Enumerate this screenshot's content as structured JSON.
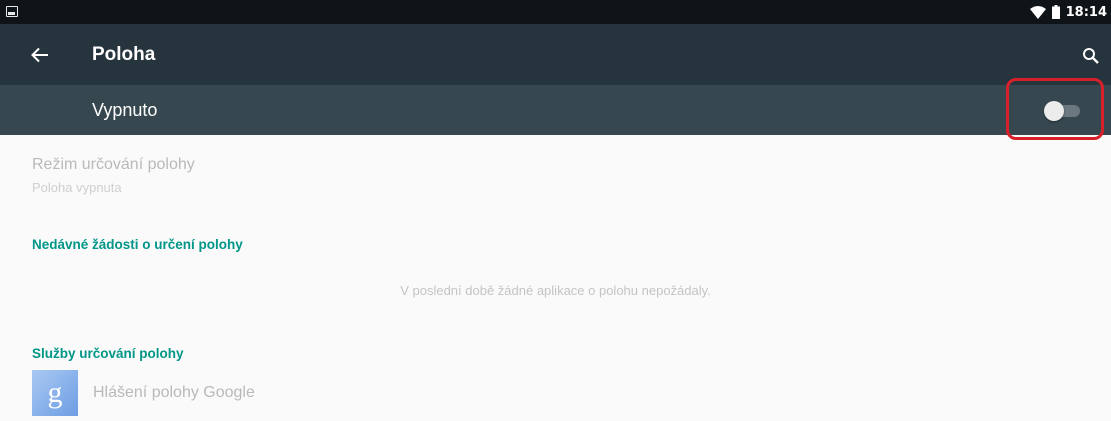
{
  "status_bar": {
    "time": "18:14",
    "notification_icon": "image-notification-icon",
    "wifi_icon": "wifi-icon",
    "battery_icon": "battery-icon"
  },
  "toolbar": {
    "back_icon": "arrow-back-icon",
    "title": "Poloha",
    "search_icon": "search-icon",
    "background": "#26353d"
  },
  "master_switch": {
    "label": "Vypnuto",
    "state": "off",
    "background": "#37474f",
    "highlight_color": "#d8202a"
  },
  "location_mode": {
    "title": "Režim určování polohy",
    "summary": "Poloha vypnuta"
  },
  "recent_requests": {
    "header": "Nedávné žádosti o určení polohy",
    "empty_text": "V poslední době žádné aplikace o polohu nepožádaly."
  },
  "location_services": {
    "header": "Služby určování polohy",
    "items": [
      {
        "label": "Hlášení polohy Google",
        "icon": "google-g-icon",
        "icon_letter": "g"
      }
    ]
  },
  "accent_color": "#009688"
}
